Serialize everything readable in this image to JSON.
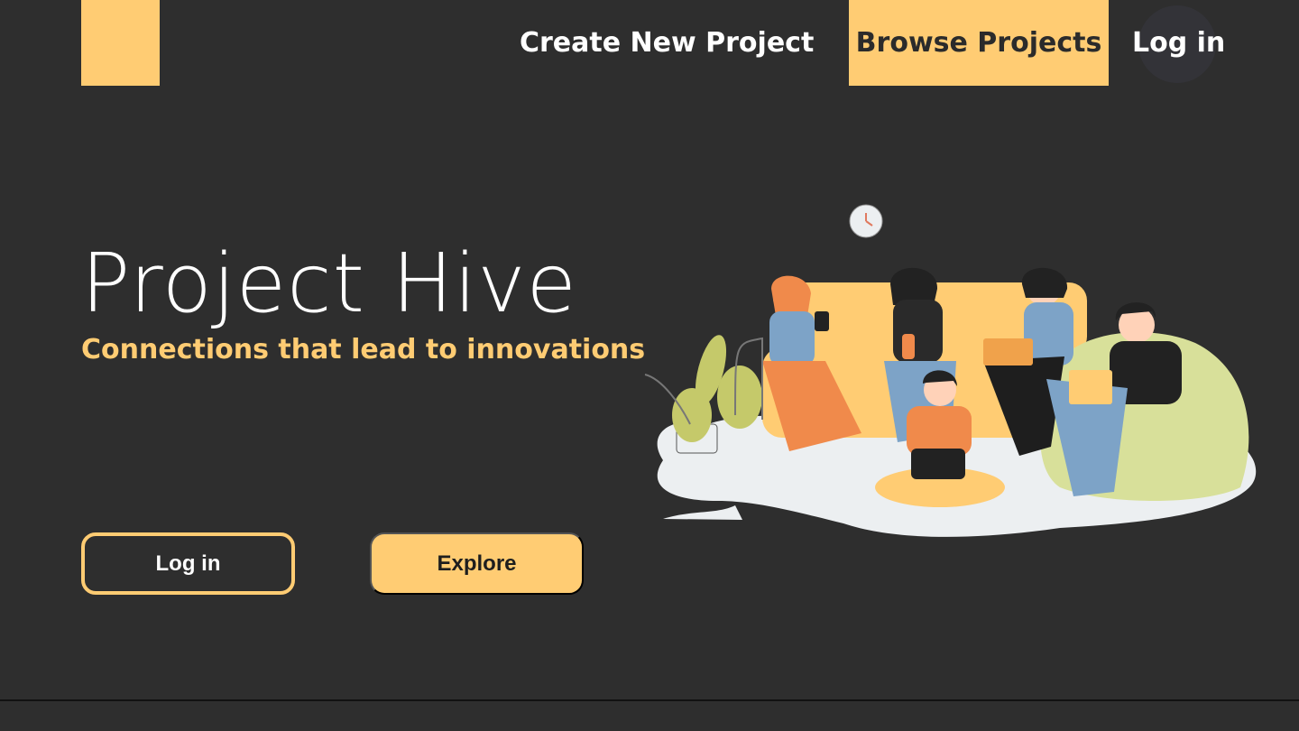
{
  "nav": {
    "create_label": "Create New Project",
    "browse_label": "Browse Projects",
    "login_label": "Log in"
  },
  "hero": {
    "title": "Project Hive",
    "subtitle": "Connections that lead to innovations",
    "login_button": "Log in",
    "explore_button": "Explore"
  },
  "colors": {
    "background": "#2e2e2e",
    "accent": "#ffcc73"
  },
  "icons": {
    "illustration": "people-collaborating-illustration"
  }
}
